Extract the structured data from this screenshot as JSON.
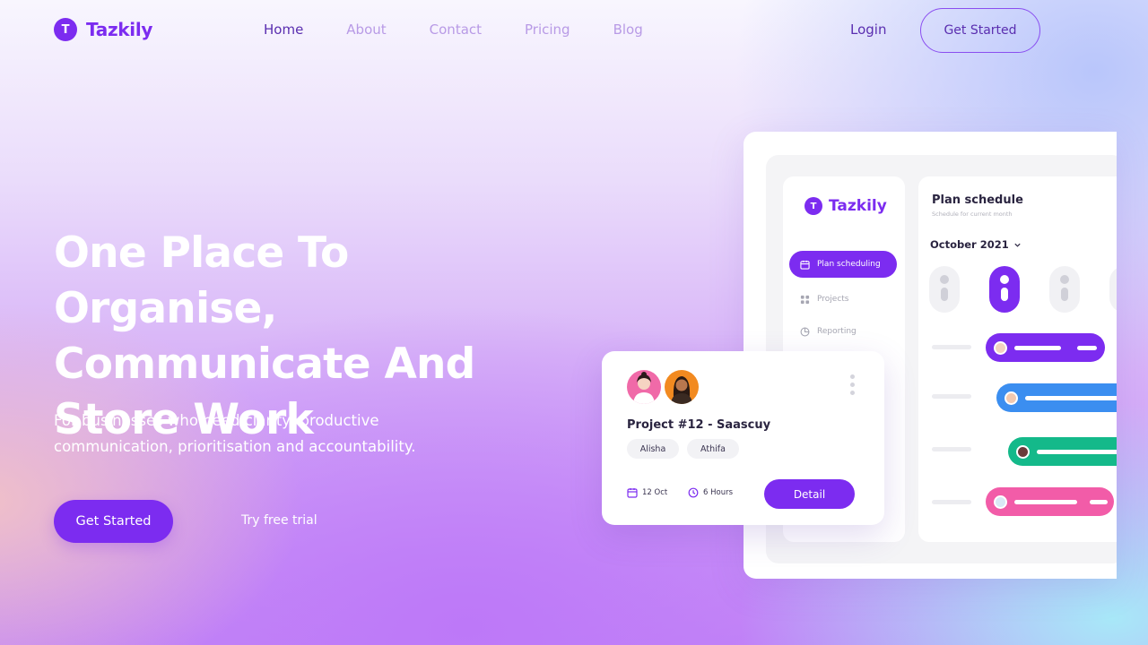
{
  "brand": {
    "letter": "T",
    "name": "Tazkily"
  },
  "nav": {
    "links": [
      {
        "label": "Home",
        "active": true
      },
      {
        "label": "About",
        "active": false
      },
      {
        "label": "Contact",
        "active": false
      },
      {
        "label": "Pricing",
        "active": false
      },
      {
        "label": "Blog",
        "active": false
      }
    ],
    "login_label": "Login",
    "cta_label": "Get Started"
  },
  "hero": {
    "title_lines": [
      "One Place To Organise,",
      "Communicate And",
      "Store Work"
    ],
    "subtitle_lines": [
      "For businesses who need clarity, productive",
      "communication, prioritisation and accountability."
    ],
    "cta_label": "Get Started",
    "secondary_label": "Try free trial"
  },
  "app_preview": {
    "sidebar": {
      "items": [
        {
          "label": "Plan scheduling",
          "icon": "calendar-icon",
          "active": true
        },
        {
          "label": "Projects",
          "icon": "grid-icon",
          "active": false
        },
        {
          "label": "Reporting",
          "icon": "pie-chart-icon",
          "active": false
        }
      ]
    },
    "schedule": {
      "title": "Plan schedule",
      "subtitle": "Schedule for current month",
      "month": "October 2021",
      "bar_colors": [
        "#7c2cf0",
        "#3b8ef0",
        "#14b98a",
        "#f25ca8"
      ]
    }
  },
  "project_card": {
    "title": "Project #12 - Saascuy",
    "members": [
      "Alisha",
      "Athifa"
    ],
    "date": "12 Oct",
    "duration": "6 Hours",
    "detail_label": "Detail"
  },
  "colors": {
    "accent": "#7c2cf0",
    "nav_active": "#5a2eb0",
    "nav_inactive": "#b89ae6"
  }
}
